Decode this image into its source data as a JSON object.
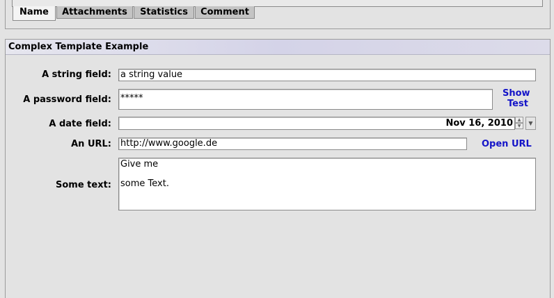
{
  "tabs": [
    {
      "label": "Name",
      "active": true
    },
    {
      "label": "Attachments",
      "active": false
    },
    {
      "label": "Statistics",
      "active": false
    },
    {
      "label": "Comment",
      "active": false
    }
  ],
  "panel": {
    "title": "Complex Template Example"
  },
  "form": {
    "string_label": "A string field:",
    "string_value": "a string value",
    "password_label": "A password field:",
    "password_value": "*****",
    "show_link": "Show",
    "test_link": "Test",
    "date_label": "A date field:",
    "date_value": "Nov 16, 2010",
    "url_label": "An URL:",
    "url_value": "http://www.google.de",
    "open_url_link": "Open URL",
    "text_label": "Some text:",
    "text_line1": "Give me",
    "text_line2": "some Text."
  },
  "colors": {
    "link": "#1414c8",
    "header_accent": "#d4d3e8"
  },
  "icons": {
    "spin_up": "spinner-up-arrow-icon",
    "spin_down": "spinner-down-arrow-icon",
    "dropdown": "chevron-down-icon"
  }
}
